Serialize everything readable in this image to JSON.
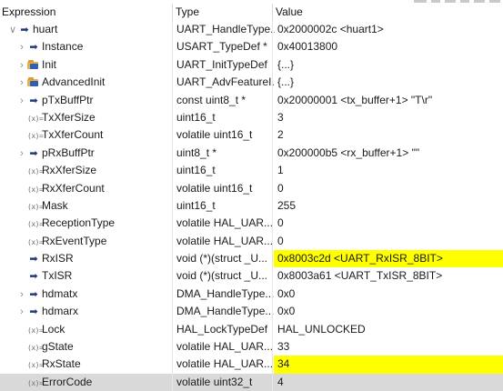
{
  "columns": {
    "expression": "Expression",
    "type": "Type",
    "value": "Value"
  },
  "icons": {
    "expanded": "chevron-down-icon",
    "collapsed": "chevron-right-icon",
    "pointer": "arrow-icon",
    "struct": "struct-icon",
    "field": "variable-icon"
  },
  "icon_glyphs": {
    "expanded": "∨",
    "collapsed": "›",
    "pointer": "➡",
    "field": "(x)="
  },
  "colors": {
    "highlight": "#ffff00",
    "selected_row": "#d9d9d9"
  },
  "rows": [
    {
      "name": "huart",
      "type": "UART_HandleType...",
      "value": "0x2000002c <huart1>",
      "expander": "expanded",
      "icon": "pointer",
      "level": 0
    },
    {
      "name": "Instance",
      "type": "USART_TypeDef *",
      "value": "0x40013800",
      "expander": "collapsed",
      "icon": "pointer",
      "level": 1
    },
    {
      "name": "Init",
      "type": "UART_InitTypeDef",
      "value": "{...}",
      "expander": "collapsed",
      "icon": "struct",
      "level": 1
    },
    {
      "name": "AdvancedInit",
      "type": "UART_AdvFeatureI...",
      "value": "{...}",
      "expander": "collapsed",
      "icon": "struct",
      "level": 1
    },
    {
      "name": "pTxBuffPtr",
      "type": "const uint8_t *",
      "value": "0x20000001 <tx_buffer+1> \"T\\r\"",
      "expander": "collapsed",
      "icon": "pointer",
      "level": 1
    },
    {
      "name": "TxXferSize",
      "type": "uint16_t",
      "value": "3",
      "expander": "",
      "icon": "field",
      "level": 1
    },
    {
      "name": "TxXferCount",
      "type": "volatile uint16_t",
      "value": "2",
      "expander": "",
      "icon": "field",
      "level": 1
    },
    {
      "name": "pRxBuffPtr",
      "type": "uint8_t *",
      "value": "0x200000b5 <rx_buffer+1> \"\"",
      "expander": "collapsed",
      "icon": "pointer",
      "level": 1
    },
    {
      "name": "RxXferSize",
      "type": "uint16_t",
      "value": "1",
      "expander": "",
      "icon": "field",
      "level": 1
    },
    {
      "name": "RxXferCount",
      "type": "volatile uint16_t",
      "value": "0",
      "expander": "",
      "icon": "field",
      "level": 1
    },
    {
      "name": "Mask",
      "type": "uint16_t",
      "value": "255",
      "expander": "",
      "icon": "field",
      "level": 1
    },
    {
      "name": "ReceptionType",
      "type": "volatile HAL_UAR...",
      "value": "0",
      "expander": "",
      "icon": "field",
      "level": 1
    },
    {
      "name": "RxEventType",
      "type": "volatile HAL_UAR...",
      "value": "0",
      "expander": "",
      "icon": "field",
      "level": 1
    },
    {
      "name": "RxISR",
      "type": "void (*)(struct _U...",
      "value": "0x8003c2d <UART_RxISR_8BIT>",
      "expander": "",
      "icon": "pointer",
      "level": 1,
      "highlight": true
    },
    {
      "name": "TxISR",
      "type": "void (*)(struct _U...",
      "value": "0x8003a61 <UART_TxISR_8BIT>",
      "expander": "",
      "icon": "pointer",
      "level": 1
    },
    {
      "name": "hdmatx",
      "type": "DMA_HandleType...",
      "value": "0x0",
      "expander": "collapsed",
      "icon": "pointer",
      "level": 1
    },
    {
      "name": "hdmarx",
      "type": "DMA_HandleType...",
      "value": "0x0",
      "expander": "collapsed",
      "icon": "pointer",
      "level": 1
    },
    {
      "name": "Lock",
      "type": "HAL_LockTypeDef",
      "value": "HAL_UNLOCKED",
      "expander": "",
      "icon": "field",
      "level": 1
    },
    {
      "name": "gState",
      "type": "volatile HAL_UAR...",
      "value": "33",
      "expander": "",
      "icon": "field",
      "level": 1
    },
    {
      "name": "RxState",
      "type": "volatile HAL_UAR...",
      "value": "34",
      "expander": "",
      "icon": "field",
      "level": 1,
      "highlight": true
    },
    {
      "name": "ErrorCode",
      "type": "volatile uint32_t",
      "value": "4",
      "expander": "",
      "icon": "field",
      "level": 1,
      "selected": true
    }
  ]
}
